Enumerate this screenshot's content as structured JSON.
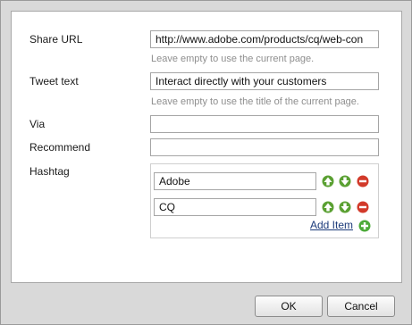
{
  "form": {
    "share_url": {
      "label": "Share URL",
      "value": "http://www.adobe.com/products/cq/web-con",
      "hint": "Leave empty to use the current page."
    },
    "tweet_text": {
      "label": "Tweet text",
      "value": "Interact directly with your customers",
      "hint": "Leave empty to use the title of the current page."
    },
    "via": {
      "label": "Via",
      "value": ""
    },
    "recommend": {
      "label": "Recommend",
      "value": ""
    },
    "hashtag": {
      "label": "Hashtag",
      "items": [
        {
          "value": "Adobe"
        },
        {
          "value": "CQ"
        }
      ],
      "add_item_label": "Add Item"
    }
  },
  "footer": {
    "ok_label": "OK",
    "cancel_label": "Cancel"
  },
  "icons": {
    "move_up": "arrow-up-icon",
    "move_down": "arrow-down-icon",
    "remove": "remove-icon",
    "add": "add-icon"
  },
  "colors": {
    "arrow_green": "#5aa032",
    "remove_red": "#d23a2a",
    "add_green": "#4caa3a",
    "link": "#1b3a7a"
  }
}
